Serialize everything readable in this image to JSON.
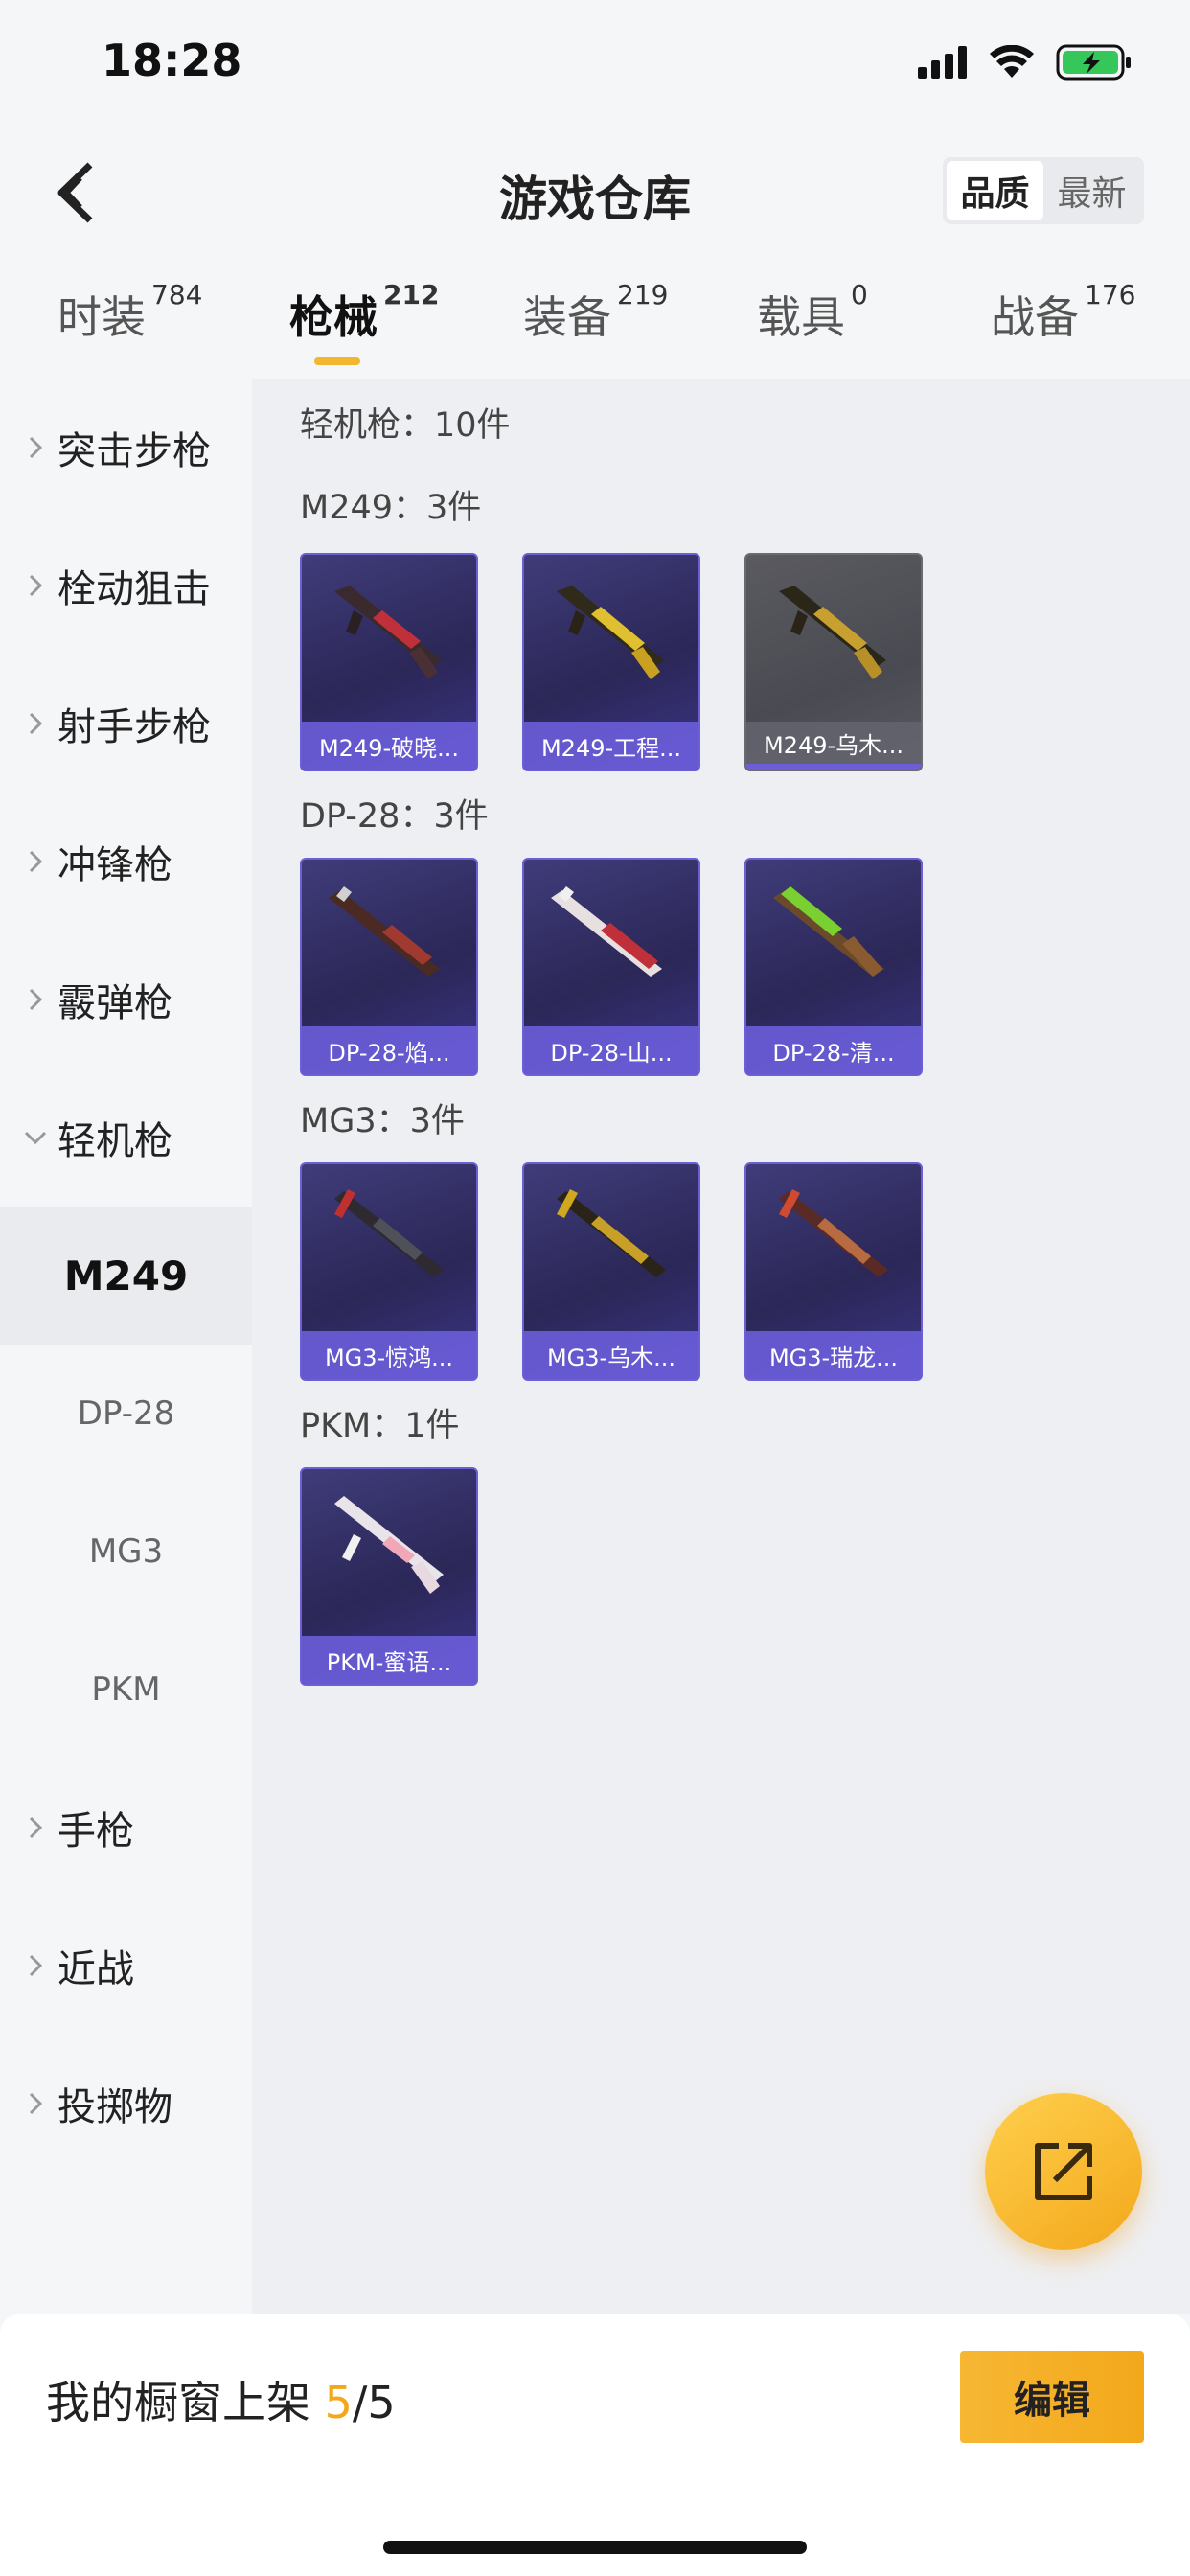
{
  "status": {
    "time": "18:28"
  },
  "header": {
    "title": "游戏仓库",
    "sort_quality": "品质",
    "sort_newest": "最新"
  },
  "tabs": [
    {
      "label": "时装",
      "count": "784"
    },
    {
      "label": "枪械",
      "count": "212"
    },
    {
      "label": "装备",
      "count": "219"
    },
    {
      "label": "载具",
      "count": "0"
    },
    {
      "label": "战备",
      "count": "176"
    }
  ],
  "sidebar": {
    "categories": [
      "突击步枪",
      "栓动狙击",
      "射手步枪",
      "冲锋枪",
      "霰弹枪",
      "轻机枪"
    ],
    "subcategories": [
      "M249",
      "DP-28",
      "MG3",
      "PKM"
    ],
    "categories_after": [
      "手枪",
      "近战",
      "投掷物"
    ]
  },
  "content": {
    "summary": "轻机枪：10件",
    "groups": [
      {
        "title": "M249：3件",
        "items": [
          "M249-破晓...",
          "M249-工程...",
          "M249-乌木..."
        ]
      },
      {
        "title": "DP-28：3件",
        "items": [
          "DP-28-焰...",
          "DP-28-山...",
          "DP-28-清..."
        ]
      },
      {
        "title": "MG3：3件",
        "items": [
          "MG3-惊鸿...",
          "MG3-乌木...",
          "MG3-瑞龙..."
        ]
      },
      {
        "title": "PKM：1件",
        "items": [
          "PKM-蜜语..."
        ]
      }
    ]
  },
  "bottom": {
    "shelf_prefix": "我的橱窗上架 ",
    "shelf_current": "5",
    "shelf_total": "/5",
    "edit_label": "编辑"
  },
  "colors": {
    "accent": "#f3a81b",
    "card_border": "#6c5fd6",
    "card_bg": "#2b2757"
  },
  "icons": [
    "back-arrow-icon",
    "signal-icon",
    "wifi-icon",
    "battery-icon",
    "chevron-right-icon",
    "chevron-down-icon",
    "share-export-icon"
  ]
}
